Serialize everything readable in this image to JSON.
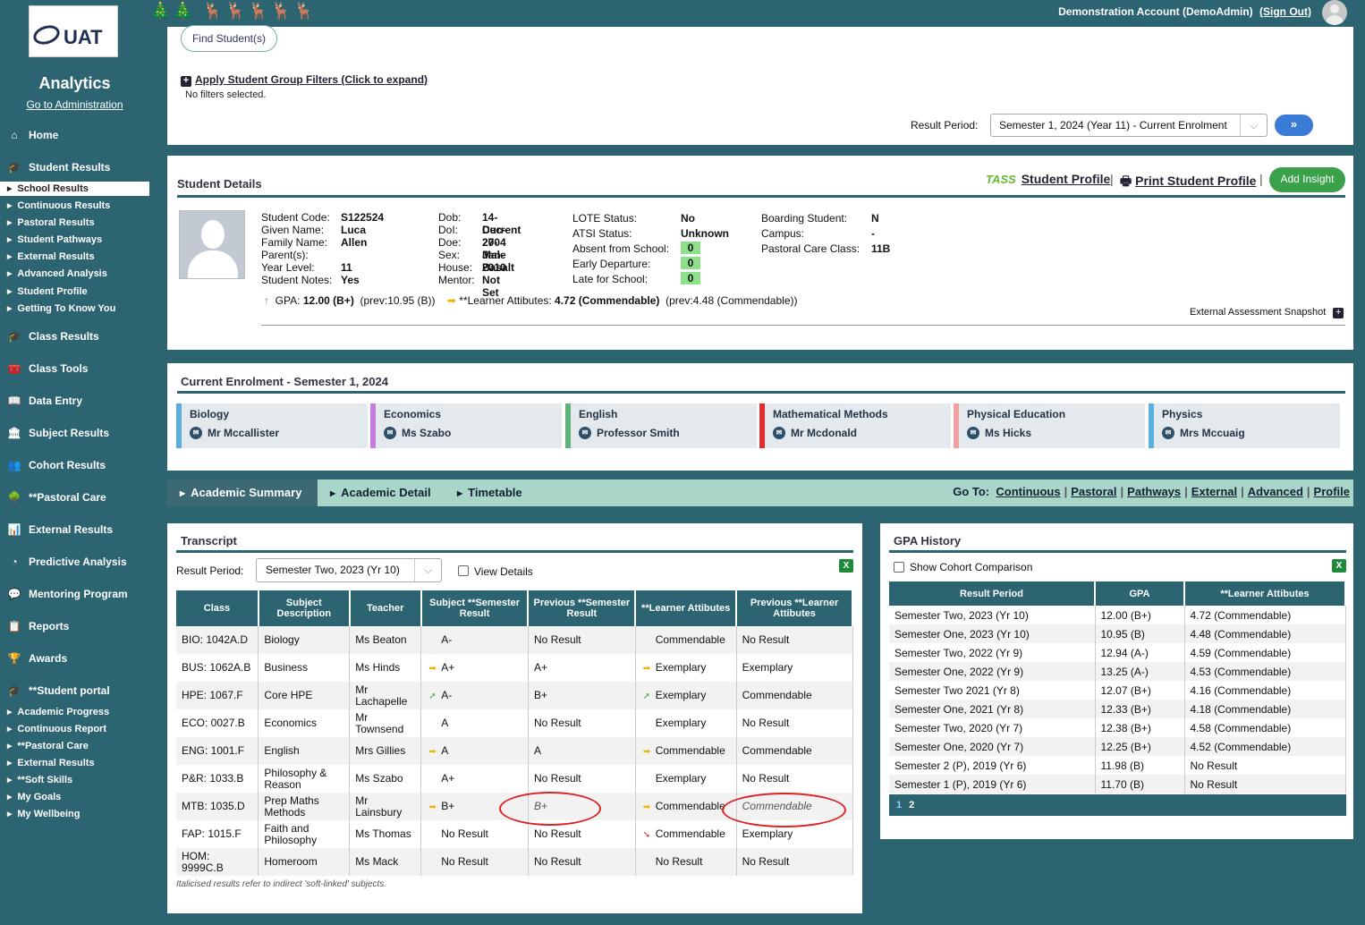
{
  "header": {
    "user": "Demonstration Account (DemoAdmin)",
    "sign_out": "(Sign Out)"
  },
  "sidebar": {
    "logo_text": "UAT",
    "title": "Analytics",
    "admin_link": "Go to Administration",
    "main": [
      {
        "label": "Home",
        "icon": "home-icon"
      },
      {
        "label": "Student Results",
        "icon": "student-results-icon"
      },
      {
        "label": "Class Results",
        "icon": "class-results-icon"
      },
      {
        "label": "Class Tools",
        "icon": "class-tools-icon"
      },
      {
        "label": "Data Entry",
        "icon": "data-entry-icon"
      },
      {
        "label": "Subject Results",
        "icon": "subject-results-icon"
      },
      {
        "label": "Cohort Results",
        "icon": "cohort-results-icon"
      },
      {
        "label": "**Pastoral Care",
        "icon": "pastoral-care-icon"
      },
      {
        "label": "External Results",
        "icon": "external-results-icon"
      },
      {
        "label": "Predictive Analysis",
        "icon": "predictive-analysis-icon"
      },
      {
        "label": "Mentoring Program",
        "icon": "mentoring-icon"
      },
      {
        "label": "Reports",
        "icon": "reports-icon"
      },
      {
        "label": "Awards",
        "icon": "awards-icon"
      },
      {
        "label": "**Student portal",
        "icon": "student-portal-icon"
      }
    ],
    "student_results_sub": [
      "School Results",
      "Continuous Results",
      "Pastoral Results",
      "Student Pathways",
      "External Results",
      "Advanced Analysis",
      "Student Profile",
      "Getting To Know You"
    ],
    "student_portal_sub": [
      "Academic Progress",
      "Continuous Report",
      "**Pastoral Care",
      "External Results",
      "**Soft Skills",
      "My Goals",
      "My Wellbeing"
    ]
  },
  "search": {
    "find_button": "Find Student(s)",
    "filters_link": "Apply Student Group Filters (Click to expand)",
    "filters_status": "No filters selected.",
    "result_period_label": "Result Period:",
    "result_period_value": "Semester 1, 2024 (Year 11) - Current Enrolment",
    "go_button": "»"
  },
  "student": {
    "heading": "Student Details",
    "profile_brand": "TASS",
    "profile_link": "Student Profile",
    "print_link": "Print Student Profile",
    "add_insight": "Add Insight",
    "col1": [
      {
        "k": "Student Code:",
        "v": "S122524"
      },
      {
        "k": "Given Name:",
        "v": "Luca"
      },
      {
        "k": "Family Name:",
        "v": "Allen"
      },
      {
        "k": "Parent(s):",
        "v": ""
      },
      {
        "k": "Year Level:",
        "v": "11"
      },
      {
        "k": "Student Notes:",
        "v": "Yes"
      }
    ],
    "col2": [
      {
        "k": "Dob:",
        "v": "14-Dec-2004"
      },
      {
        "k": "DoI:",
        "v": "Current"
      },
      {
        "k": "Doe:",
        "v": "27-Jan-2010"
      },
      {
        "k": "Sex:",
        "v": "Male"
      },
      {
        "k": "House:",
        "v": "Basalt"
      },
      {
        "k": "Mentor:",
        "v": "Not Set"
      }
    ],
    "col3": [
      {
        "k": "LOTE Status:",
        "v": "No"
      },
      {
        "k": "ATSI Status:",
        "v": "Unknown"
      },
      {
        "k": "Absent from School:",
        "v": "0"
      },
      {
        "k": "Early Departure:",
        "v": "0"
      },
      {
        "k": "Late for School:",
        "v": "0"
      }
    ],
    "col4": [
      {
        "k": "Boarding Student:",
        "v": "N"
      },
      {
        "k": "Campus:",
        "v": "-"
      },
      {
        "k": "Pastoral Care Class:",
        "v": "11B"
      }
    ],
    "gpa_label": "GPA:",
    "gpa_value": "12.00 (B+)",
    "gpa_prev": "(prev:10.95 (B))",
    "la_label": "**Learner Attibutes:",
    "la_value": "4.72 (Commendable)",
    "la_prev": "(prev:4.48 (Commendable))",
    "ext_snapshot": "External Assessment Snapshot"
  },
  "enrolment": {
    "heading": "Current Enrolment - Semester 1, 2024",
    "subjects": [
      {
        "name": "Biology",
        "teacher": "Mr Mccallister",
        "color": "#5aaedc"
      },
      {
        "name": "Economics",
        "teacher": "Ms Szabo",
        "color": "#c77ce0"
      },
      {
        "name": "English",
        "teacher": "Professor Smith",
        "color": "#5fb27a"
      },
      {
        "name": "Mathematical Methods",
        "teacher": "Mr Mcdonald",
        "color": "#e52d2d"
      },
      {
        "name": "Physical Education",
        "teacher": "Ms Hicks",
        "color": "#f0a0a0"
      },
      {
        "name": "Physics",
        "teacher": "Mrs Mccuaig",
        "color": "#5ab0e0"
      }
    ]
  },
  "tabs": [
    "Academic Summary",
    "Academic Detail",
    "Timetable"
  ],
  "goto": {
    "label": "Go To:",
    "links": [
      "Continuous",
      "Pastoral",
      "Pathways",
      "External",
      "Advanced",
      "Profile"
    ]
  },
  "transcript": {
    "heading": "Transcript",
    "rp_label": "Result Period:",
    "rp_value": "Semester Two, 2023 (Yr 10)",
    "view_details": "View Details",
    "excel": "X",
    "headers": [
      "Class",
      "Subject Description",
      "Teacher",
      "Subject **Semester Result",
      "Previous **Semester Result",
      "**Learner Attibutes",
      "Previous **Learner Attibutes"
    ],
    "rows": [
      {
        "cls": "BIO: 1042A.D",
        "desc": "Biology",
        "teacher": "Ms Beaton",
        "arr": "",
        "res": "A-",
        "prev": "No Result",
        "la_arr": "",
        "la": "Commendable",
        "prev_la": "No Result"
      },
      {
        "cls": "BUS: 1062A.B",
        "desc": "Business",
        "teacher": "Ms Hinds",
        "arr": "➡",
        "res": "A+",
        "prev": "A+",
        "la_arr": "➡",
        "la": "Exemplary",
        "prev_la": "Exemplary"
      },
      {
        "cls": "HPE: 1067.F",
        "desc": "Core HPE",
        "teacher": "Mr Lachapelle",
        "arr": "➚",
        "res": "A-",
        "prev": "B+",
        "la_arr": "➚",
        "la": "Exemplary",
        "prev_la": "Commendable"
      },
      {
        "cls": "ECO: 0027.B",
        "desc": "Economics",
        "teacher": "Mr Townsend",
        "arr": "",
        "res": "A",
        "prev": "No Result",
        "la_arr": "",
        "la": "Exemplary",
        "prev_la": "No Result"
      },
      {
        "cls": "ENG: 1001.F",
        "desc": "English",
        "teacher": "Mrs Gillies",
        "arr": "➡",
        "res": "A",
        "prev": "A",
        "la_arr": "➡",
        "la": "Commendable",
        "prev_la": "Commendable"
      },
      {
        "cls": "P&R: 1033.B",
        "desc": "Philosophy & Reason",
        "teacher": "Ms Szabo",
        "arr": "",
        "res": "A+",
        "prev": "No Result",
        "la_arr": "",
        "la": "Exemplary",
        "prev_la": "No Result"
      },
      {
        "cls": "MTB: 1035.D",
        "desc": "Prep Maths Methods",
        "teacher": "Mr Lainsbury",
        "arr": "➡",
        "res": "B+",
        "prev": "B+",
        "la_arr": "➡",
        "la": "Commendable",
        "prev_la": "Commendable",
        "prev_italic": true
      },
      {
        "cls": "FAP: 1015.F",
        "desc": "Faith and Philosophy",
        "teacher": "Ms Thomas",
        "arr": "",
        "res": "No Result",
        "prev": "No Result",
        "la_arr": "➘",
        "la": "Commendable",
        "prev_la": "Exemplary"
      },
      {
        "cls": "HOM: 9999C.B",
        "desc": "Homeroom",
        "teacher": "Ms Mack",
        "arr": "",
        "res": "No Result",
        "prev": "No Result",
        "la_arr": "",
        "la": "No Result",
        "prev_la": "No Result"
      }
    ],
    "note": "Italicised results refer to indirect 'soft-linked' subjects."
  },
  "gpa_history": {
    "heading": "GPA History",
    "cohort_label": "Show Cohort Comparison",
    "excel": "X",
    "headers": [
      "Result Period",
      "GPA",
      "**Learner Attibutes"
    ],
    "rows": [
      [
        "Semester Two, 2023 (Yr 10)",
        "12.00 (B+)",
        "4.72 (Commendable)"
      ],
      [
        "Semester One, 2023 (Yr 10)",
        "10.95 (B)",
        "4.48 (Commendable)"
      ],
      [
        "Semester Two, 2022 (Yr 9)",
        "12.94 (A-)",
        "4.59 (Commendable)"
      ],
      [
        "Semester One, 2022 (Yr 9)",
        "13.25 (A-)",
        "4.53 (Commendable)"
      ],
      [
        "Semester Two 2021 (Yr 8)",
        "12.07 (B+)",
        "4.16 (Commendable)"
      ],
      [
        "Semester One, 2021 (Yr 8)",
        "12.33 (B+)",
        "4.18 (Commendable)"
      ],
      [
        "Semester Two, 2020 (Yr 7)",
        "12.38 (B+)",
        "4.58 (Commendable)"
      ],
      [
        "Semester One, 2020 (Yr 7)",
        "12.25 (B+)",
        "4.52 (Commendable)"
      ],
      [
        "Semester 2 (P), 2019 (Yr 6)",
        "11.98 (B)",
        "No Result"
      ],
      [
        "Semester 1 (P), 2019 (Yr 6)",
        "11.70 (B)",
        "No Result"
      ]
    ],
    "pages": [
      "1",
      "2"
    ]
  }
}
